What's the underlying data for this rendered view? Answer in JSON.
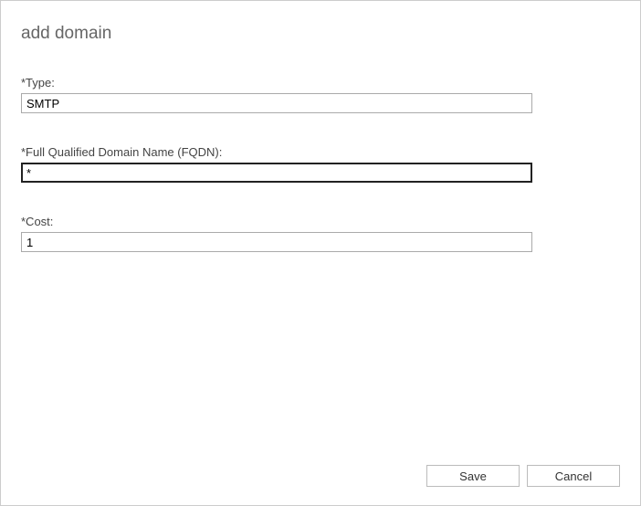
{
  "dialog": {
    "title": "add domain"
  },
  "form": {
    "type": {
      "label": "*Type:",
      "value": "SMTP"
    },
    "fqdn": {
      "label": "*Full Qualified Domain Name (FQDN):",
      "value": "*"
    },
    "cost": {
      "label": "*Cost:",
      "value": "1"
    }
  },
  "buttons": {
    "save": "Save",
    "cancel": "Cancel"
  }
}
